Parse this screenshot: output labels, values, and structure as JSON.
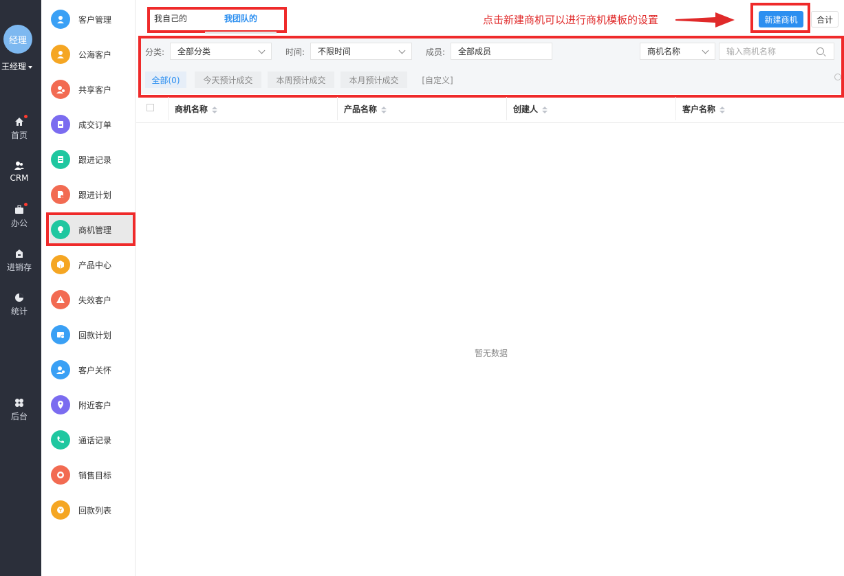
{
  "rail": {
    "avatar_text": "经理",
    "username": "王经理",
    "items": [
      {
        "label": "首页",
        "icon": "home-icon",
        "badge": true
      },
      {
        "label": "CRM",
        "icon": "crm-users-icon",
        "badge": false
      },
      {
        "label": "办公",
        "icon": "briefcase-icon",
        "badge": true
      },
      {
        "label": "进销存",
        "icon": "warehouse-icon",
        "badge": false
      },
      {
        "label": "统计",
        "icon": "pie-chart-icon",
        "badge": false
      },
      {
        "label": "后台",
        "icon": "grid-icon",
        "badge": false
      }
    ]
  },
  "submenu": {
    "items": [
      {
        "label": "客户管理",
        "icon": "customer-icon",
        "color": "#3aa0f5"
      },
      {
        "label": "公海客户",
        "icon": "public-customer-icon",
        "color": "#f5a623"
      },
      {
        "label": "共享客户",
        "icon": "share-customer-icon",
        "color": "#f26b52"
      },
      {
        "label": "成交订单",
        "icon": "order-icon",
        "color": "#7b6cf0"
      },
      {
        "label": "跟进记录",
        "icon": "followup-record-icon",
        "color": "#1fc7a0"
      },
      {
        "label": "跟进计划",
        "icon": "followup-plan-icon",
        "color": "#f26b52"
      },
      {
        "label": "商机管理",
        "icon": "lightbulb-icon",
        "color": "#1fc7a0"
      },
      {
        "label": "产品中心",
        "icon": "box-icon",
        "color": "#f5a623"
      },
      {
        "label": "失效客户",
        "icon": "warning-icon",
        "color": "#f26b52"
      },
      {
        "label": "回款计划",
        "icon": "payment-plan-icon",
        "color": "#3aa0f5"
      },
      {
        "label": "客户关怀",
        "icon": "care-icon",
        "color": "#3aa0f5"
      },
      {
        "label": "附近客户",
        "icon": "location-icon",
        "color": "#7b6cf0"
      },
      {
        "label": "通话记录",
        "icon": "phone-icon",
        "color": "#1fc7a0"
      },
      {
        "label": "销售目标",
        "icon": "target-icon",
        "color": "#f26b52"
      },
      {
        "label": "回款列表",
        "icon": "payment-list-icon",
        "color": "#f5a623"
      }
    ]
  },
  "header": {
    "tab_mine": "我自己的",
    "tab_team": "我团队的",
    "annotation": "点击新建商机可以进行商机模板的设置",
    "new_button": "新建商机",
    "total_button": "合计"
  },
  "filters": {
    "category_label": "分类:",
    "category_value": "全部分类",
    "time_label": "时间:",
    "time_value": "不限时间",
    "member_label": "成员:",
    "member_value": "全部成员",
    "search_field": "商机名称",
    "search_placeholder": "输入商机名称",
    "quick_tabs": [
      "全部(0)",
      "今天预计成交",
      "本周预计成交",
      "本月预计成交",
      "[自定义]"
    ]
  },
  "table": {
    "columns": [
      "商机名称",
      "产品名称",
      "创建人",
      "客户名称"
    ],
    "empty_text": "暂无数据"
  },
  "colors": {
    "primary": "#2c8ff0",
    "annotation": "#e02a2a",
    "rail_bg": "#2b2f3a"
  }
}
